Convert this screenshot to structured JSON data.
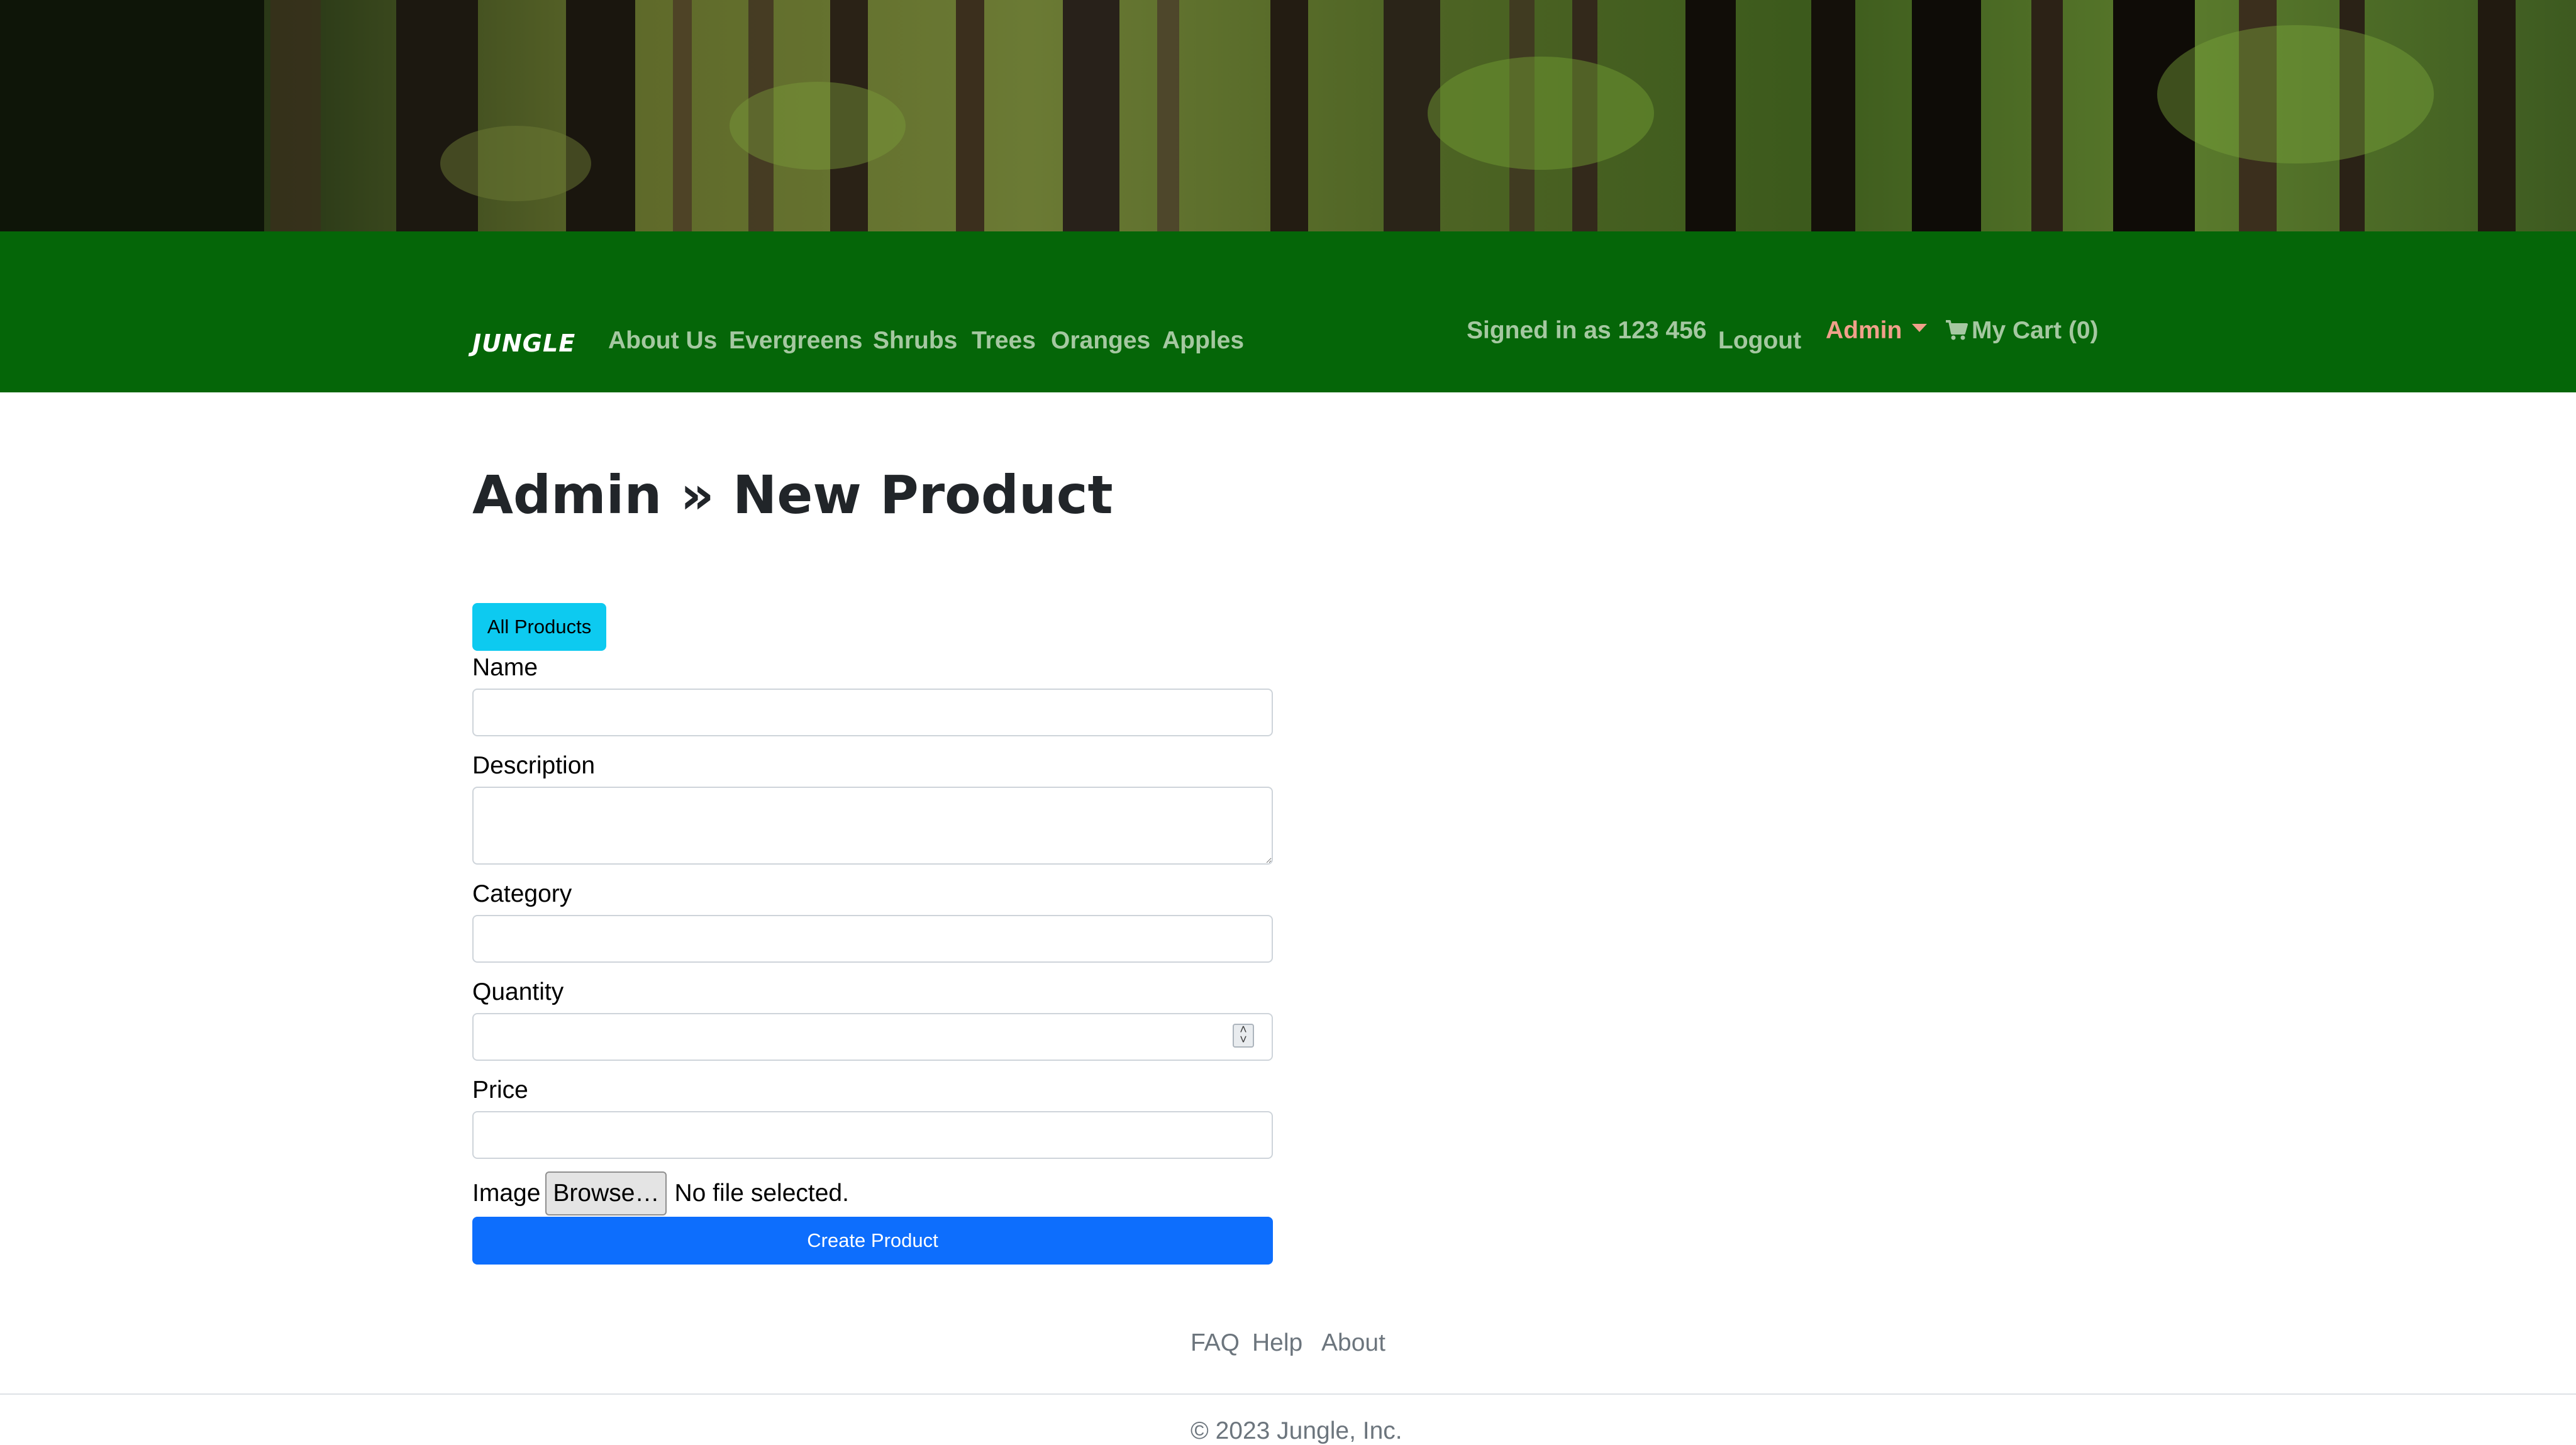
{
  "nav": {
    "brand": "JUNGLE",
    "links": [
      "About Us",
      "Evergreens",
      "Shrubs",
      "Trees",
      "Oranges",
      "Apples"
    ],
    "signed_in": "Signed in as 123 456",
    "logout": "Logout",
    "admin": "Admin",
    "cart": "My Cart (0)"
  },
  "page": {
    "title": "Admin » New Product",
    "all_products_button": "All Products"
  },
  "form": {
    "name_label": "Name",
    "name_value": "",
    "description_label": "Description",
    "description_value": "",
    "category_label": "Category",
    "category_value": "",
    "quantity_label": "Quantity",
    "quantity_value": "",
    "price_label": "Price",
    "price_value": "",
    "image_label": "Image",
    "browse_button": "Browse…",
    "no_file": "No file selected.",
    "submit": "Create Product"
  },
  "footer": {
    "links": [
      "FAQ",
      "Help",
      "About"
    ],
    "copyright": "© 2023 Jungle, Inc."
  },
  "colors": {
    "nav_bg": "#056608",
    "nav_link": "#a5c8a1",
    "admin_link": "#f0a08a",
    "info_button": "#0dcaf0",
    "primary_button": "#0d6efd"
  },
  "icons": [
    "cart-icon",
    "caret-down-icon",
    "spinner-icon"
  ]
}
